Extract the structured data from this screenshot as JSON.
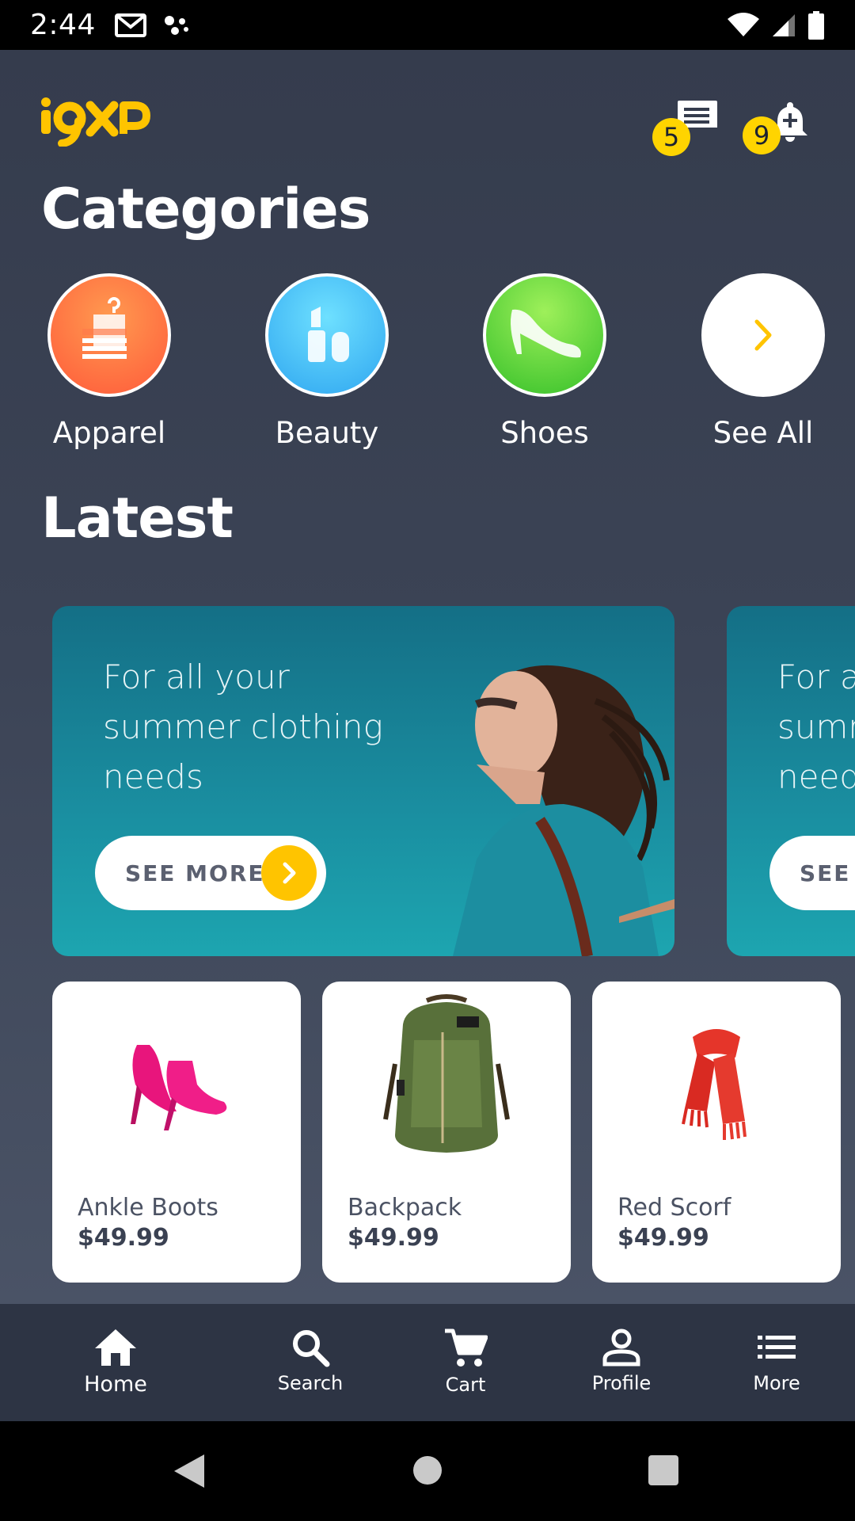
{
  "status_bar": {
    "time": "2:44"
  },
  "header": {
    "logo_text": "i9XP",
    "messages_badge": "5",
    "notifications_badge": "9"
  },
  "categories": {
    "title": "Categories",
    "items": [
      {
        "label": "Apparel",
        "icon": "apparel-icon",
        "color": "#ff6a3d"
      },
      {
        "label": "Beauty",
        "icon": "lipstick-icon",
        "color": "#3cb8f2"
      },
      {
        "label": "Shoes",
        "icon": "high-heel-icon",
        "color": "#4ccd2c"
      },
      {
        "label": "See All",
        "icon": "chevron-right-icon",
        "color": "#ffffff"
      }
    ]
  },
  "latest": {
    "title": "Latest",
    "banners": [
      {
        "line1": "For all your",
        "line2": "summer clothing",
        "line3": "needs",
        "button": "SEE MORE"
      },
      {
        "line1": "For al",
        "line2": "sumn",
        "line3": "needs",
        "button": "SEE M"
      }
    ]
  },
  "products": [
    {
      "name": "Ankle Boots",
      "price": "$49.99",
      "icon": "ankle-boots-image"
    },
    {
      "name": "Backpack",
      "price": "$49.99",
      "icon": "backpack-image"
    },
    {
      "name": "Red Scorf",
      "price": "$49.99",
      "icon": "scarf-image"
    }
  ],
  "bottom_nav": [
    {
      "label": "Home",
      "icon": "home-icon",
      "active": true
    },
    {
      "label": "Search",
      "icon": "search-icon"
    },
    {
      "label": "Cart",
      "icon": "cart-icon"
    },
    {
      "label": "Profile",
      "icon": "profile-icon"
    },
    {
      "label": "More",
      "icon": "list-icon"
    }
  ],
  "colors": {
    "accent": "#ffc400",
    "background": "#3b4355",
    "nav": "#2d3444"
  }
}
